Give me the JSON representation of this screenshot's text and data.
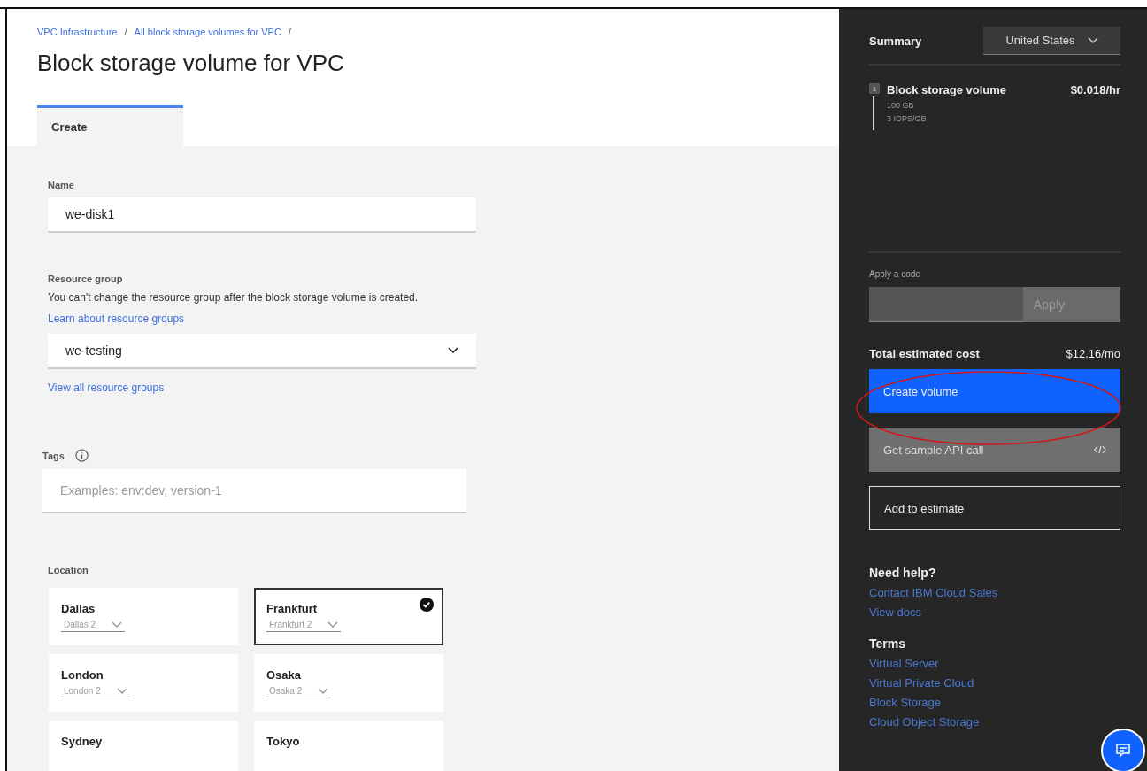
{
  "breadcrumbs": [
    {
      "label": "VPC Infrastructure",
      "separator": "/"
    },
    {
      "label": "All block storage volumes for VPC",
      "separator": "/"
    }
  ],
  "page_title": "Block storage volume for VPC",
  "tabs": [
    {
      "label": "Create",
      "selected": true
    }
  ],
  "form": {
    "name": {
      "label": "Name",
      "value": "we-disk1"
    },
    "resource_group": {
      "label": "Resource group",
      "help": "You can't change the resource group after the block storage volume is created.",
      "learn_link": "Learn about resource groups",
      "value": "we-testing",
      "view_link": "View all resource groups"
    },
    "tags": {
      "label": "Tags",
      "placeholder": "Examples: env:dev, version-1"
    },
    "location": {
      "label": "Location",
      "options": [
        {
          "name": "Dallas",
          "zone": "Dallas 2",
          "selected": false
        },
        {
          "name": "Frankfurt",
          "zone": "Frankfurt 2",
          "selected": true
        },
        {
          "name": "London",
          "zone": "London 2",
          "selected": false
        },
        {
          "name": "Osaka",
          "zone": "Osaka 2",
          "selected": false
        },
        {
          "name": "Sydney",
          "selected": false
        },
        {
          "name": "Tokyo",
          "selected": false
        }
      ]
    }
  },
  "summary": {
    "title": "Summary",
    "region": "United States",
    "items": [
      {
        "count": "1",
        "name": "Block storage volume",
        "price": "$0.018/hr",
        "details": [
          "100 GB",
          "3 IOPS/GB"
        ]
      }
    ],
    "code_label": "Apply a code",
    "apply_button": "Apply",
    "total_label": "Total estimated cost",
    "total": "$12.16/mo",
    "create_button": "Create volume",
    "api_button": "Get sample API call",
    "estimate_button": "Add to estimate",
    "help_title": "Need help?",
    "help_links": [
      "Contact IBM Cloud Sales",
      "View docs"
    ],
    "terms_title": "Terms",
    "terms_links": [
      "Virtual Server",
      "Virtual Private Cloud",
      "Block Storage",
      "Cloud Object Storage"
    ]
  }
}
